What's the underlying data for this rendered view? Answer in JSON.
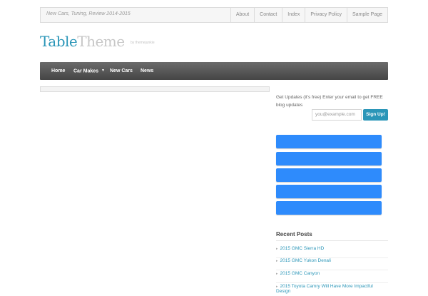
{
  "site": {
    "tagline": "New Cars, Tuning, Review 2014-2015",
    "logo_part1": "Table",
    "logo_part2": "Theme",
    "logo_by": "by themejunkie"
  },
  "top_links": [
    "About",
    "Contact",
    "Index",
    "Privacy Policy",
    "Sample Page"
  ],
  "nav": {
    "items": [
      {
        "label": "Home"
      },
      {
        "label": "Car Makes",
        "has_dropdown": true
      },
      {
        "label": "New Cars"
      },
      {
        "label": "News"
      }
    ],
    "dropdown_icon": "caret-down-icon"
  },
  "sidebar": {
    "updates_text": "Get Updates (it's free) Enter your email to get FREE blog updates",
    "email_placeholder": "you@example.com",
    "signup_label": "Sign Up!",
    "recent_posts_title": "Recent Posts",
    "recent_posts": [
      "2015 GMC Sierra HD",
      "2015 GMC Yukon Denali",
      "2015 GMC Canyon",
      "2015 Toyota Camry Will Have More Impactful Design"
    ],
    "ad_color": "#2e8bfc"
  },
  "colors": {
    "accent": "#2b96b8",
    "nav_bg": "#555555"
  }
}
